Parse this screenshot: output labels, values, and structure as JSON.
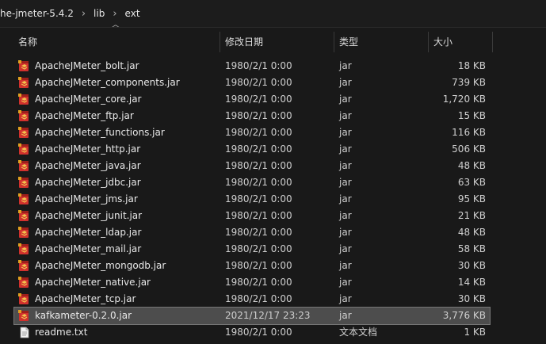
{
  "address_bar": {
    "crumbs": [
      "he-jmeter-5.4.2",
      "lib",
      "ext"
    ]
  },
  "columns": {
    "name": "名称",
    "modified": "修改日期",
    "type": "类型",
    "size": "大小"
  },
  "files": [
    {
      "name": "ApacheJMeter_bolt.jar",
      "modified": "1980/2/1 0:00",
      "type": "jar",
      "size": "18 KB",
      "icon": "jar-file-icon"
    },
    {
      "name": "ApacheJMeter_components.jar",
      "modified": "1980/2/1 0:00",
      "type": "jar",
      "size": "739 KB",
      "icon": "jar-file-icon"
    },
    {
      "name": "ApacheJMeter_core.jar",
      "modified": "1980/2/1 0:00",
      "type": "jar",
      "size": "1,720 KB",
      "icon": "jar-file-icon"
    },
    {
      "name": "ApacheJMeter_ftp.jar",
      "modified": "1980/2/1 0:00",
      "type": "jar",
      "size": "15 KB",
      "icon": "jar-file-icon"
    },
    {
      "name": "ApacheJMeter_functions.jar",
      "modified": "1980/2/1 0:00",
      "type": "jar",
      "size": "116 KB",
      "icon": "jar-file-icon"
    },
    {
      "name": "ApacheJMeter_http.jar",
      "modified": "1980/2/1 0:00",
      "type": "jar",
      "size": "506 KB",
      "icon": "jar-file-icon"
    },
    {
      "name": "ApacheJMeter_java.jar",
      "modified": "1980/2/1 0:00",
      "type": "jar",
      "size": "48 KB",
      "icon": "jar-file-icon"
    },
    {
      "name": "ApacheJMeter_jdbc.jar",
      "modified": "1980/2/1 0:00",
      "type": "jar",
      "size": "63 KB",
      "icon": "jar-file-icon"
    },
    {
      "name": "ApacheJMeter_jms.jar",
      "modified": "1980/2/1 0:00",
      "type": "jar",
      "size": "95 KB",
      "icon": "jar-file-icon"
    },
    {
      "name": "ApacheJMeter_junit.jar",
      "modified": "1980/2/1 0:00",
      "type": "jar",
      "size": "21 KB",
      "icon": "jar-file-icon"
    },
    {
      "name": "ApacheJMeter_ldap.jar",
      "modified": "1980/2/1 0:00",
      "type": "jar",
      "size": "48 KB",
      "icon": "jar-file-icon"
    },
    {
      "name": "ApacheJMeter_mail.jar",
      "modified": "1980/2/1 0:00",
      "type": "jar",
      "size": "58 KB",
      "icon": "jar-file-icon"
    },
    {
      "name": "ApacheJMeter_mongodb.jar",
      "modified": "1980/2/1 0:00",
      "type": "jar",
      "size": "30 KB",
      "icon": "jar-file-icon"
    },
    {
      "name": "ApacheJMeter_native.jar",
      "modified": "1980/2/1 0:00",
      "type": "jar",
      "size": "14 KB",
      "icon": "jar-file-icon"
    },
    {
      "name": "ApacheJMeter_tcp.jar",
      "modified": "1980/2/1 0:00",
      "type": "jar",
      "size": "30 KB",
      "icon": "jar-file-icon"
    },
    {
      "name": "kafkameter-0.2.0.jar",
      "modified": "2021/12/17 23:23",
      "type": "jar",
      "size": "3,776 KB",
      "icon": "jar-file-icon",
      "selected": true
    },
    {
      "name": "readme.txt",
      "modified": "1980/2/1 0:00",
      "type": "文本文档",
      "size": "1 KB",
      "icon": "text-file-icon"
    }
  ],
  "colors": {
    "background": "#191919",
    "selection": "#4d4d4d",
    "text": "#e6e6e6",
    "jar_icon_red": "#d0312d",
    "jar_icon_gold": "#e0a020"
  }
}
